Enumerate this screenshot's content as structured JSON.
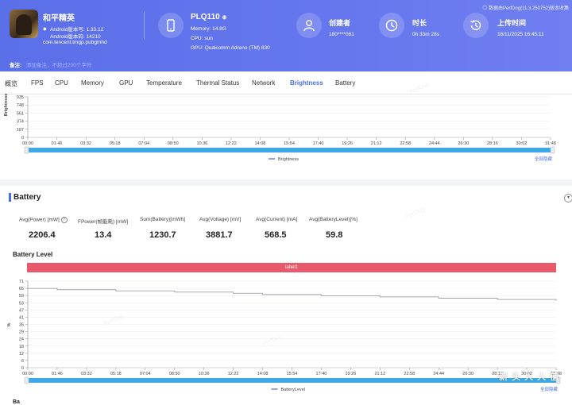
{
  "header": {
    "app_name": "和平精英",
    "android_version": "Android版本号: 1.33.12",
    "android_code": "Android版本码: 14210",
    "package": "com.tencent.tmgp.pubgmhd",
    "device_name": "PLQ110",
    "device_badge": "⊕",
    "memory": "Memory: 14.8G",
    "cpu": "CPU: sun",
    "gpu": "GPU: Qualcomm Adreno (TM) 830",
    "creator_title": "创建者",
    "creator_value": "180****061",
    "duration_title": "时长",
    "duration_value": "0h 33m 28s",
    "upload_title": "上传时间",
    "upload_value": "16/11/2025 16:45:11",
    "upload_note": "◎ 数据由PerfDog(11.3.250752)版本收集",
    "note_label": "备注:",
    "note_placeholder": "添加备注，不超过200个字符",
    "colors": {
      "header_bg": "#5b6fe9",
      "accent": "#4a6fe0",
      "label_bar": "#e8596b",
      "scroll": "#3fa9e8"
    }
  },
  "tabs": [
    {
      "label": "概览"
    },
    {
      "label": "FPS"
    },
    {
      "label": "CPU"
    },
    {
      "label": "Memory"
    },
    {
      "label": "GPU"
    },
    {
      "label": "Temperature"
    },
    {
      "label": "Thermal Status"
    },
    {
      "label": "Network"
    },
    {
      "label": "Brightness",
      "active": true
    },
    {
      "label": "Battery"
    }
  ],
  "brightness_panel": {
    "legend": "Brightness",
    "show_all": "全部隐藏"
  },
  "battery": {
    "section_title": "Battery",
    "collapse_icon": "chevron-down-icon",
    "stats": [
      {
        "label": "Avg(Power) [mW]",
        "value": "2206.4",
        "help": "?"
      },
      {
        "label": "FPower(帧能耗) [mW]",
        "value": "13.4"
      },
      {
        "label": "Sum(Battery)[mWh]",
        "value": "1230.7"
      },
      {
        "label": "Avg(Voltage) [mV]",
        "value": "3881.7"
      },
      {
        "label": "Avg(Current) [mA]",
        "value": "568.5"
      },
      {
        "label": "Avg(BatteryLevel)[%]",
        "value": "59.8"
      }
    ],
    "chart_title": "Battery Level",
    "label_bar": "label1",
    "legend": "BatteryLevel",
    "show_all": "全部隐藏",
    "next_section_stub": "Ba"
  },
  "watermark": "PerfDog",
  "corner_brand": "新 头 人 人 值",
  "chart_data": [
    {
      "type": "line",
      "title": "",
      "xlabel": "",
      "ylabel": "Brightness",
      "ylim": [
        0,
        935
      ],
      "yticks": [
        "935",
        "748",
        "561",
        "374",
        "187",
        "0"
      ],
      "x": [
        "00:00",
        "01:46",
        "03:32",
        "05:18",
        "07:04",
        "08:50",
        "10:36",
        "12:22",
        "14:08",
        "15:54",
        "17:40",
        "19:26",
        "21:12",
        "22:58",
        "24:44",
        "26:30",
        "28:16",
        "30:02",
        "31:48"
      ],
      "series": [
        {
          "name": "Brightness",
          "values": []
        }
      ],
      "grid": true,
      "legend": "bottom-center"
    },
    {
      "type": "line",
      "title": "Battery Level",
      "xlabel": "",
      "ylabel": "%",
      "ylim": [
        0,
        71
      ],
      "yticks": [
        "71",
        "65",
        "59",
        "53",
        "47",
        "41",
        "35",
        "29",
        "24",
        "18",
        "12",
        "6",
        "0"
      ],
      "x": [
        "00:00",
        "01:46",
        "03:32",
        "05:18",
        "07:04",
        "08:50",
        "10:36",
        "12:22",
        "14:08",
        "15:54",
        "17:40",
        "19:26",
        "21:12",
        "22:58",
        "24:44",
        "26:30",
        "28:16",
        "30:02",
        "31:48"
      ],
      "series": [
        {
          "name": "BatteryLevel",
          "values": [
            65,
            64,
            64,
            63,
            63,
            62,
            62,
            61,
            60,
            60,
            59,
            59,
            58,
            58,
            57,
            57,
            56,
            56,
            55
          ]
        }
      ],
      "grid": true,
      "legend": "bottom-center"
    }
  ]
}
